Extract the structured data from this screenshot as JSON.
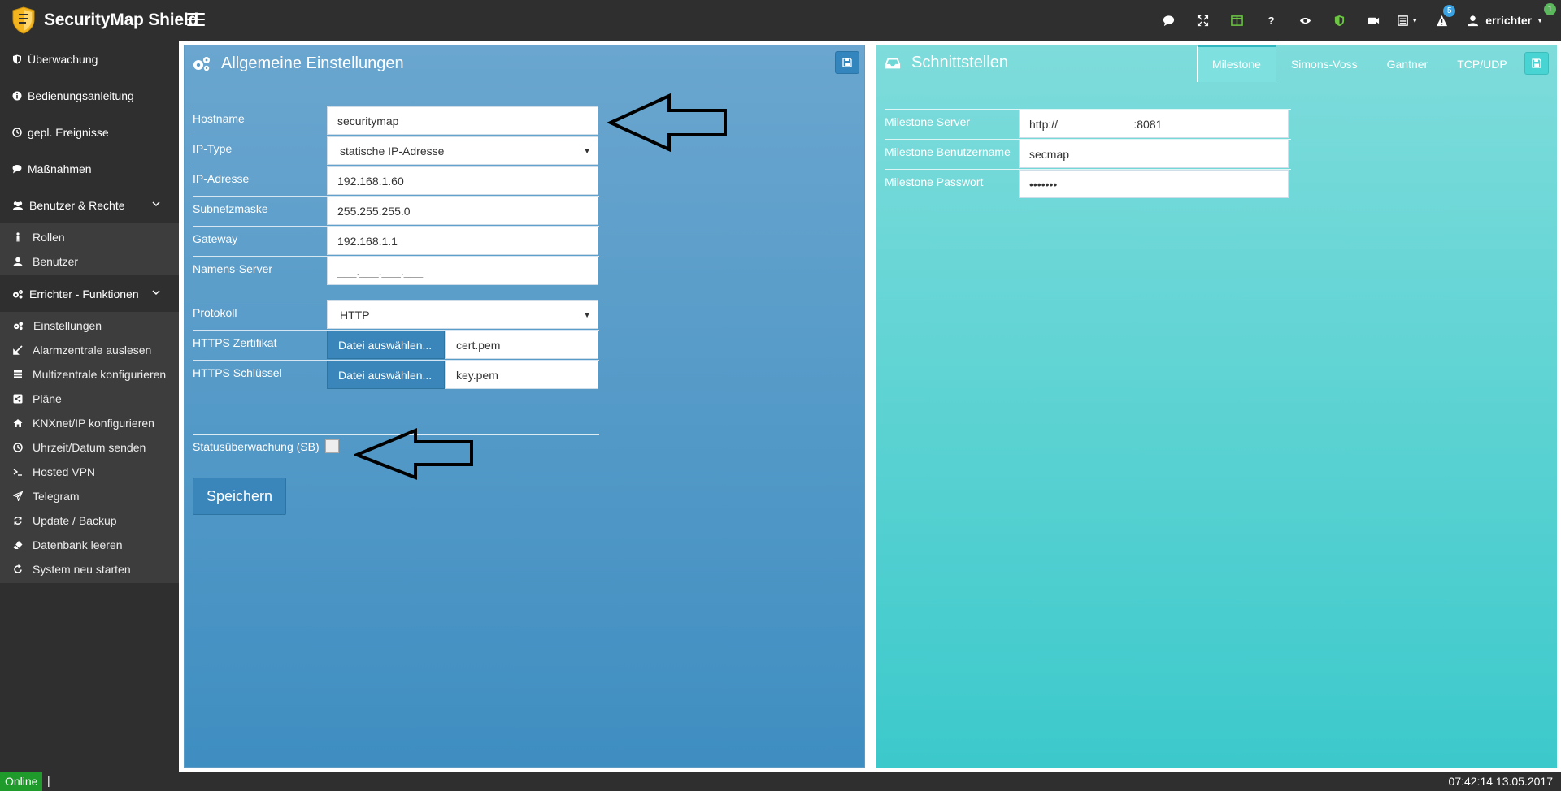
{
  "app": {
    "brand": "SecurityMap Shield",
    "user": "errichter",
    "alerts_count": "5",
    "user_badge": "1"
  },
  "icons": [
    "comment-icon",
    "expand-icon",
    "columns-icon",
    "help-icon",
    "eye-icon",
    "shield-icon",
    "video-icon",
    "list-icon",
    "alert-icon",
    "user-icon"
  ],
  "sidebar": {
    "items": [
      {
        "label": "Überwachung",
        "icon": "shield-icon"
      },
      {
        "label": "Bedienungsanleitung",
        "icon": "info-icon"
      },
      {
        "label": "gepl. Ereignisse",
        "icon": "clock-icon"
      },
      {
        "label": "Maßnahmen",
        "icon": "comment-icon"
      },
      {
        "label": "Benutzer & Rechte",
        "icon": "users-icon"
      }
    ],
    "users_sub": [
      {
        "label": "Rollen",
        "icon": "person-icon"
      },
      {
        "label": "Benutzer",
        "icon": "user-icon"
      }
    ],
    "installer": {
      "label": "Errichter - Funktionen",
      "icon": "gears-icon"
    },
    "installer_sub": [
      {
        "label": "Einstellungen",
        "icon": "gears-icon"
      },
      {
        "label": "Alarmzentrale auslesen",
        "icon": "import-icon"
      },
      {
        "label": "Multizentrale konfigurieren",
        "icon": "server-icon"
      },
      {
        "label": "Pläne",
        "icon": "share-icon"
      },
      {
        "label": "KNXnet/IP konfigurieren",
        "icon": "home-icon"
      },
      {
        "label": "Uhrzeit/Datum senden",
        "icon": "clock-icon"
      },
      {
        "label": "Hosted VPN",
        "icon": "terminal-icon"
      },
      {
        "label": "Telegram",
        "icon": "send-icon"
      },
      {
        "label": "Update / Backup",
        "icon": "refresh-icon"
      },
      {
        "label": "Datenbank leeren",
        "icon": "eraser-icon"
      },
      {
        "label": "System neu starten",
        "icon": "restart-icon"
      }
    ]
  },
  "left_panel": {
    "title": "Allgemeine Einstellungen",
    "fields": {
      "hostname_label": "Hostname",
      "hostname_value": "securitymap",
      "iptype_label": "IP-Type",
      "iptype_value": "statische IP-Adresse",
      "ip_label": "IP-Adresse",
      "ip_value": "192.168.1.60",
      "subnet_label": "Subnetzmaske",
      "subnet_value": "255.255.255.0",
      "gateway_label": "Gateway",
      "gateway_value": "192.168.1.1",
      "dns_label": "Namens-Server",
      "dns_placeholder": "___.___.___.___",
      "protocol_label": "Protokoll",
      "protocol_value": "HTTP",
      "cert_label": "HTTPS Zertifikat",
      "cert_button": "Datei auswählen...",
      "cert_file": "cert.pem",
      "key_label": "HTTPS Schlüssel",
      "key_button": "Datei auswählen...",
      "key_file": "key.pem",
      "status_label": "Statusüberwachung (SB)"
    },
    "save_button": "Speichern"
  },
  "right_panel": {
    "title": "Schnittstellen",
    "tabs": [
      "Milestone",
      "Simons-Voss",
      "Gantner",
      "TCP/UDP"
    ],
    "active_tab": "Milestone",
    "fields": {
      "server_label": "Milestone Server",
      "server_value": "http://                        :8081",
      "user_label": "Milestone Benutzername",
      "user_value": "secmap",
      "password_label": "Milestone Passwort",
      "password_value": "•••••••"
    }
  },
  "footer": {
    "status": "Online",
    "cursor": "|",
    "datetime": "07:42:14 13.05.2017"
  },
  "colors": {
    "topbar": "#2f2f2f",
    "left_panel": "#4f97c6",
    "right_panel": "#5ed6d5",
    "online": "#1e9b2a",
    "alert_badge": "#3aa3e3",
    "user_badge": "#5cb85c"
  }
}
